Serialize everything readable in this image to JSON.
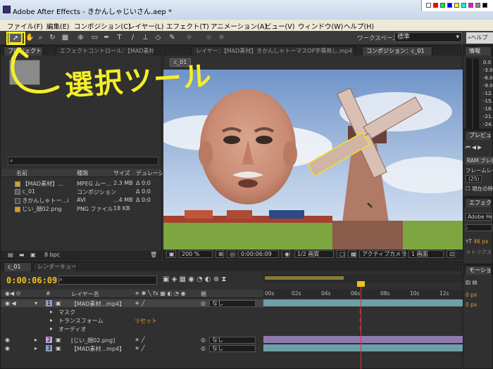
{
  "window": {
    "title": "Adobe After Effects - きかんしゃじいさん.aep *"
  },
  "menu": [
    "ファイル(F)",
    "編集(E)",
    "コンポジション(C)",
    "レイヤー(L)",
    "エフェクト(T)",
    "アニメーション(A)",
    "ビュー(V)",
    "ウィンドウ(W)",
    "ヘルプ(H)"
  ],
  "toolbar": {
    "workspace_label": "ワークスペース：",
    "workspace_value": "標準",
    "help_search": "ヘルプを"
  },
  "project_panel": {
    "tabs": [
      "プロジェクト",
      "エフェクトコントロール：【MAD素材】"
    ],
    "columns": [
      "名前",
      "種類",
      "サイズ",
      "デュレーション"
    ],
    "items": [
      {
        "name": "【MAD素材】...",
        "type": "MPEG ムー...",
        "size": "2.3 MB",
        "dur": "Δ 0:0",
        "color": "#d4a020"
      },
      {
        "name": "c_01",
        "type": "コンポジション",
        "size": "",
        "dur": "Δ 0:0",
        "color": "#8a8a8a"
      },
      {
        "name": "きかんしゃトー...i",
        "type": "AVI",
        "size": "...4 MB",
        "dur": "Δ 0:0",
        "color": "#8a8a8a"
      },
      {
        "name": "じい_顔02.png",
        "type": "PNG ファイル",
        "size": "18 KB",
        "dur": "",
        "color": "#d4a020"
      }
    ],
    "bpc": "8 bpc"
  },
  "viewer": {
    "tabs": [
      "レイヤー：【MAD素材】きかんしゃトーマスOP字幕無し.mp4",
      "コンポジション：c_01"
    ],
    "comp_chip": "c_01",
    "zoom": "200 %",
    "timecode": "0:00:06:09",
    "resolution": "1/2 画質",
    "camera": "アクティブカメラ",
    "views": "1 画面"
  },
  "right": {
    "info_title": "情報",
    "meter_labels": [
      "0.0",
      "-3.0",
      "-6.0",
      "-9.0",
      "-12.0",
      "-15.0",
      "-18.0",
      "-21.0",
      "-24.0"
    ],
    "preview_title": "プレビュー",
    "ram_preview": "RAM プレビュ",
    "frame_rate": "フレームレー",
    "frame_value": "(25)",
    "current_time": "現在の時",
    "effects_title": "エフェクト&",
    "font_name": "Adobe Hei",
    "font_size": "46 px",
    "font_style": "メトリクス",
    "motion_title": "モーション",
    "px1": "0 px",
    "px2": "0 px"
  },
  "timeline": {
    "tabs": [
      "c_01",
      "レンダーキュー"
    ],
    "timecode": "0:00:06:09",
    "columns": [
      "#",
      "レイヤー名",
      "親"
    ],
    "ruler": [
      "00s",
      "02s",
      "04s",
      "06s",
      "08s",
      "10s",
      "12s"
    ],
    "layers": [
      {
        "num": "1",
        "name": "【MAD素材...mp4】",
        "parent": "なし"
      },
      {
        "num": "2",
        "name": "[じい_顔02.png]",
        "parent": "なし"
      },
      {
        "num": "3",
        "name": "【MAD素材...mp4】",
        "parent": "なし"
      }
    ],
    "props": [
      "マスク",
      "トランスフォーム",
      "オーディオ"
    ],
    "reset": "リセット"
  },
  "annotation": {
    "text": "選択ツール"
  }
}
